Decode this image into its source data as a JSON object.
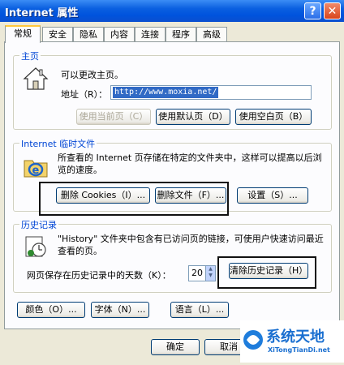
{
  "window": {
    "title": "Internet 属性"
  },
  "tabs": [
    "常规",
    "安全",
    "隐私",
    "内容",
    "连接",
    "程序",
    "高级"
  ],
  "homepage": {
    "label": "主页",
    "desc": "可以更改主页。",
    "address_label": "地址（R）：",
    "address_value": "http://www.moxia.net/",
    "buttons": [
      "使用当前页（C）",
      "使用默认页（D）",
      "使用空白页（B）"
    ]
  },
  "temp_files": {
    "label": "Internet 临时文件",
    "desc": "所查看的 Internet 页存储在特定的文件夹中，这样可以提高以后浏览的速度。",
    "buttons": [
      "删除 Cookies（I）...",
      "删除文件（F）...",
      "设置（S）..."
    ]
  },
  "history": {
    "label": "历史记录",
    "desc": "\"History\" 文件夹中包含有已访问页的链接，可使用户快速访问最近查看的页。",
    "days_label": "网页保存在历史记录中的天数（K）：",
    "days_value": "20",
    "clear_button": "清除历史记录（H）"
  },
  "bottom_buttons": [
    "颜色（O）...",
    "字体（N）...",
    "语言（L）..."
  ],
  "dialog_buttons": {
    "ok": "确定",
    "cancel": "取消"
  },
  "watermark": {
    "text": "系统天地",
    "url": "XiTongTianDi.net"
  },
  "colors": {
    "titlebar": "#0a5fe0",
    "group_label": "#0046d5",
    "selection": "#316ac5",
    "active_tab_accent": "#ffc83c"
  }
}
